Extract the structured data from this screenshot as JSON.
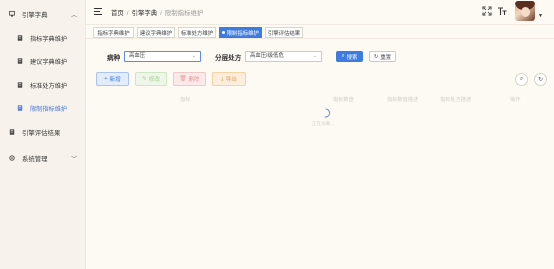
{
  "sidebar": {
    "groups": [
      {
        "label": "引擎字典",
        "expanded": true
      },
      {
        "label": "引擎评估结果",
        "expanded": false
      },
      {
        "label": "系统管理",
        "expanded": false
      }
    ],
    "items": [
      {
        "label": "指标字典维护",
        "active": false
      },
      {
        "label": "建议字典维护",
        "active": false
      },
      {
        "label": "标准处方维护",
        "active": false
      },
      {
        "label": "限制指标维护",
        "active": true
      }
    ]
  },
  "header": {
    "breadcrumb": [
      "首页",
      "引擎字典",
      "限制指标维护"
    ],
    "icons": [
      "fullscreen-icon",
      "font-size-icon"
    ]
  },
  "tabs": [
    {
      "label": "指标字典维护",
      "active": false
    },
    {
      "label": "建议字典维护",
      "active": false
    },
    {
      "label": "标准处方维护",
      "active": false
    },
    {
      "label": "限制指标维护",
      "active": true
    },
    {
      "label": "引擎评估结果",
      "active": false
    }
  ],
  "filters": {
    "disease_label": "病种",
    "disease_value": "高血压",
    "tier_label": "分层处方",
    "tier_value": "高血压I级低危",
    "search_label": "搜索",
    "reset_label": "重置"
  },
  "toolbar": {
    "add": "新增",
    "edit": "修改",
    "delete": "删除",
    "export": "导出"
  },
  "table": {
    "columns": [
      "指标",
      "指标数值",
      "指标数值描述",
      "指标处方描述",
      "操作"
    ]
  },
  "loading": {
    "text": "正在加载..."
  },
  "colors": {
    "accent": "#3d7be0",
    "active_menu": "#4a78d8"
  }
}
